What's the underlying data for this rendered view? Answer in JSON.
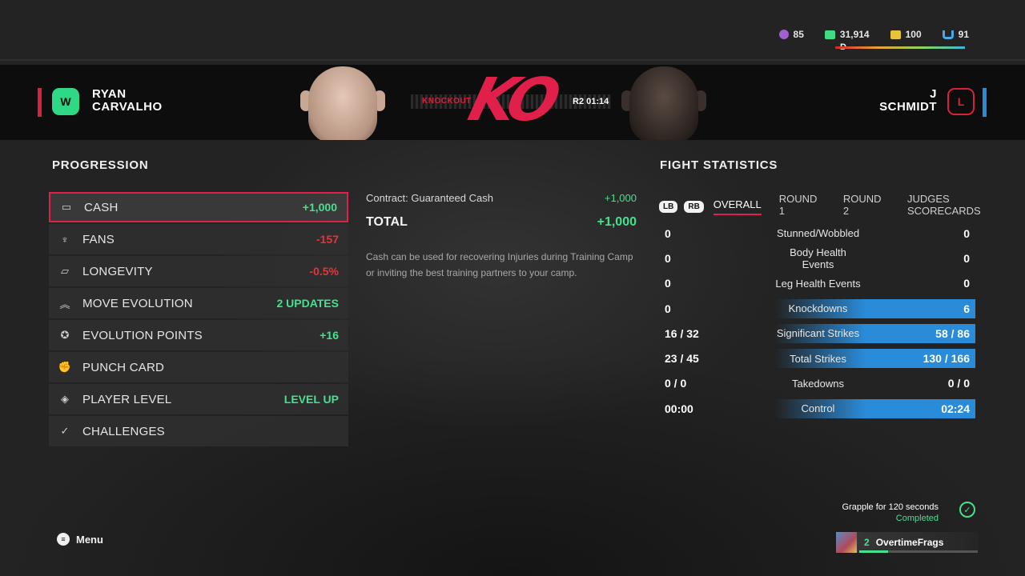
{
  "currencies": [
    {
      "icon": "coin-icon",
      "value": "85"
    },
    {
      "icon": "cash-icon",
      "value": "31,914"
    },
    {
      "icon": "calendar-icon",
      "value": "100"
    },
    {
      "icon": "fans-icon",
      "value": "91"
    }
  ],
  "rank_letter": "D",
  "fighters": {
    "left": {
      "first": "RYAN",
      "last": "CARVALHO",
      "badge": "W"
    },
    "right": {
      "first": "J",
      "last": "SCHMIDT",
      "badge": "L"
    }
  },
  "result": {
    "method": "KNOCKOUT",
    "ko_text": "KO",
    "time": "R2 01:14"
  },
  "progression": {
    "title": "PROGRESSION",
    "items": [
      {
        "label": "CASH",
        "value": "+1,000",
        "tone": "pos",
        "icon": "cash-icon"
      },
      {
        "label": "FANS",
        "value": "-157",
        "tone": "neg",
        "icon": "fans-icon"
      },
      {
        "label": "LONGEVITY",
        "value": "-0.5%",
        "tone": "neg",
        "icon": "battery-icon"
      },
      {
        "label": "MOVE EVOLUTION",
        "value": "2 UPDATES",
        "tone": "pos",
        "icon": "chevrons-up-icon"
      },
      {
        "label": "EVOLUTION POINTS",
        "value": "+16",
        "tone": "pos",
        "icon": "star-circle-icon"
      },
      {
        "label": "PUNCH CARD",
        "value": "",
        "tone": "pos",
        "icon": "glove-icon"
      },
      {
        "label": "PLAYER LEVEL",
        "value": "LEVEL UP",
        "tone": "pos",
        "icon": "diamond-icon"
      },
      {
        "label": "CHALLENGES",
        "value": "",
        "tone": "pos",
        "icon": "check-circle-icon"
      }
    ]
  },
  "detail": {
    "line_label": "Contract: Guaranteed Cash",
    "line_value": "+1,000",
    "total_label": "TOTAL",
    "total_value": "+1,000",
    "description": "Cash can be used for recovering Injuries during Training Camp or inviting the best training partners to your camp."
  },
  "fight_stats": {
    "title": "FIGHT STATISTICS",
    "lb": "LB",
    "rb": "RB",
    "tabs": [
      "OVERALL",
      "ROUND 1",
      "ROUND 2",
      "JUDGES SCORECARDS"
    ],
    "rows": [
      {
        "left": "0",
        "label": "Stunned/Wobbled",
        "right": "0",
        "highlight": false
      },
      {
        "left": "0",
        "label": "Body Health Events",
        "right": "0",
        "highlight": false
      },
      {
        "left": "0",
        "label": "Leg Health Events",
        "right": "0",
        "highlight": false
      },
      {
        "left": "0",
        "label": "Knockdowns",
        "right": "6",
        "highlight": true
      },
      {
        "left": "16 / 32",
        "label": "Significant Strikes",
        "right": "58 / 86",
        "highlight": true
      },
      {
        "left": "23 / 45",
        "label": "Total Strikes",
        "right": "130 / 166",
        "highlight": true
      },
      {
        "left": "0 / 0",
        "label": "Takedowns",
        "right": "0 / 0",
        "highlight": false
      },
      {
        "left": "00:00",
        "label": "Control",
        "right": "02:24",
        "highlight": true
      }
    ]
  },
  "menu_label": "Menu",
  "challenge": {
    "title": "Grapple for 120 seconds",
    "status": "Completed"
  },
  "player": {
    "level": "2",
    "name": "OvertimeFrags",
    "progress": 0.24
  },
  "colors": {
    "accent": "#e0204a",
    "positive": "#47e08e",
    "negative": "#e0363c",
    "blue": "#2a8bd8"
  }
}
